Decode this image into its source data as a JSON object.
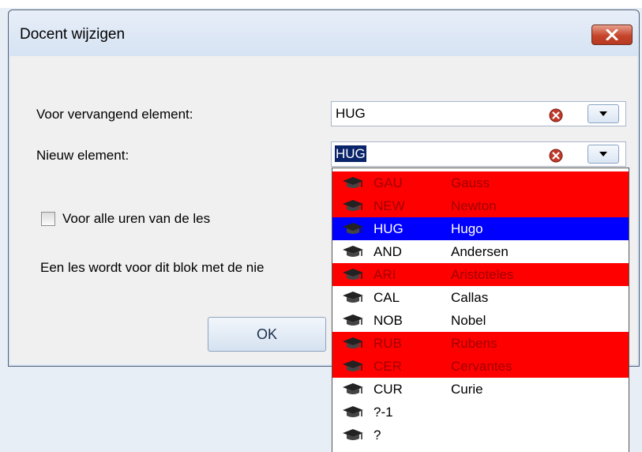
{
  "dialog": {
    "title": "Docent wijzigen"
  },
  "form": {
    "replace_label": "Voor vervangend element:",
    "replace_value": "HUG",
    "new_label": "Nieuw element:",
    "new_value": "HUG",
    "checkbox_label": "Voor alle uren van de les",
    "checkbox_checked": false,
    "info_text": "Een les wordt voor dit blok met de nie",
    "ok_label": "OK"
  },
  "dropdown": {
    "items": [
      {
        "code": "GAU",
        "name": "Gauss",
        "highlight": "red"
      },
      {
        "code": "NEW",
        "name": "Newton",
        "highlight": "red"
      },
      {
        "code": "HUG",
        "name": "Hugo",
        "highlight": "blue"
      },
      {
        "code": "AND",
        "name": "Andersen",
        "highlight": "none"
      },
      {
        "code": "ARI",
        "name": "Aristoteles",
        "highlight": "red"
      },
      {
        "code": "CAL",
        "name": "Callas",
        "highlight": "none"
      },
      {
        "code": "NOB",
        "name": "Nobel",
        "highlight": "none"
      },
      {
        "code": "RUB",
        "name": "Rubens",
        "highlight": "red"
      },
      {
        "code": "CER",
        "name": "Cervantes",
        "highlight": "red"
      },
      {
        "code": "CUR",
        "name": "Curie",
        "highlight": "none"
      },
      {
        "code": "?-1",
        "name": "",
        "highlight": "none"
      },
      {
        "code": "?",
        "name": "",
        "highlight": "none"
      }
    ]
  },
  "colors": {
    "highlight_red": "#ff0000",
    "highlight_blue": "#0000ff",
    "clear_icon": "#c0392b"
  },
  "icons": {
    "close": "close-icon",
    "clear": "clear-icon",
    "dropdown": "chevron-down-icon",
    "teacher": "graduation-cap-icon"
  }
}
